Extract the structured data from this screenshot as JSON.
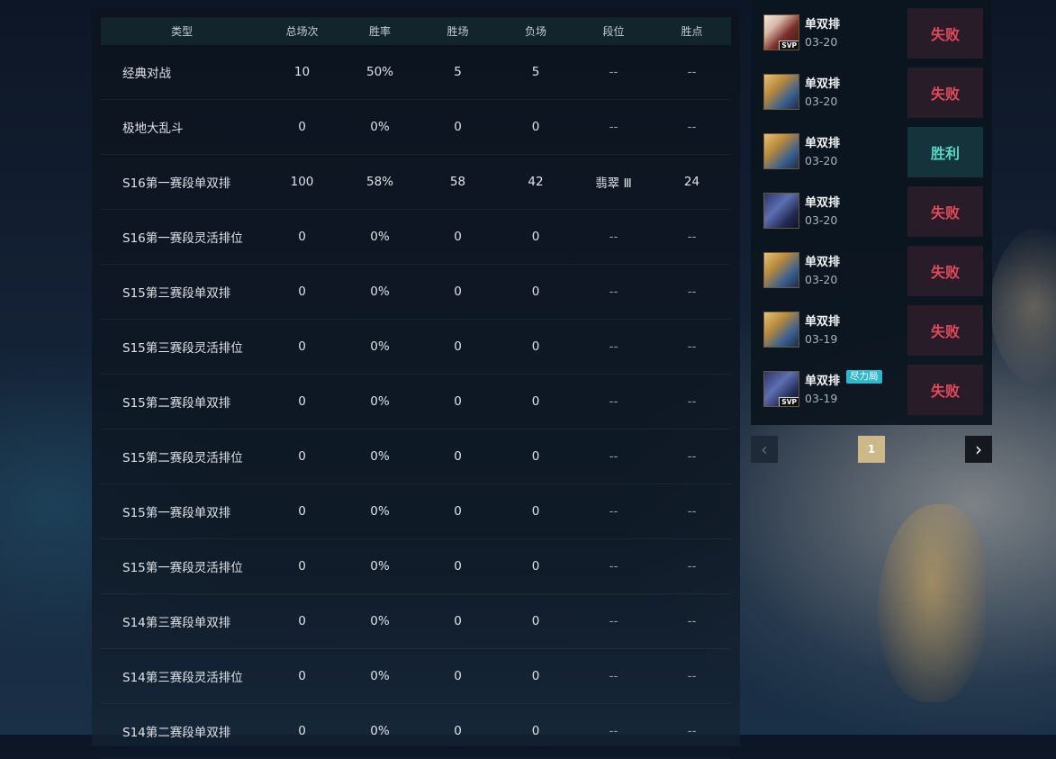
{
  "stats": {
    "columns": [
      "类型",
      "总场次",
      "胜率",
      "胜场",
      "负场",
      "段位",
      "胜点"
    ],
    "rows": [
      [
        "经典对战",
        "10",
        "50%",
        "5",
        "5",
        "--",
        "--"
      ],
      [
        "极地大乱斗",
        "0",
        "0%",
        "0",
        "0",
        "--",
        "--"
      ],
      [
        "S16第一赛段单双排",
        "100",
        "58%",
        "58",
        "42",
        "翡翠 Ⅲ",
        "24"
      ],
      [
        "S16第一赛段灵活排位",
        "0",
        "0%",
        "0",
        "0",
        "--",
        "--"
      ],
      [
        "S15第三赛段单双排",
        "0",
        "0%",
        "0",
        "0",
        "--",
        "--"
      ],
      [
        "S15第三赛段灵活排位",
        "0",
        "0%",
        "0",
        "0",
        "--",
        "--"
      ],
      [
        "S15第二赛段单双排",
        "0",
        "0%",
        "0",
        "0",
        "--",
        "--"
      ],
      [
        "S15第二赛段灵活排位",
        "0",
        "0%",
        "0",
        "0",
        "--",
        "--"
      ],
      [
        "S15第一赛段单双排",
        "0",
        "0%",
        "0",
        "0",
        "--",
        "--"
      ],
      [
        "S15第一赛段灵活排位",
        "0",
        "0%",
        "0",
        "0",
        "--",
        "--"
      ],
      [
        "S14第三赛段单双排",
        "0",
        "0%",
        "0",
        "0",
        "--",
        "--"
      ],
      [
        "S14第三赛段灵活排位",
        "0",
        "0%",
        "0",
        "0",
        "--",
        "--"
      ],
      [
        "S14第二赛段单双排",
        "0",
        "0%",
        "0",
        "0",
        "--",
        "--"
      ]
    ]
  },
  "history": {
    "matches": [
      {
        "mode": "单双排",
        "date": "03-20",
        "result": "失败",
        "avatar_style": "light",
        "svp": "SVP",
        "tag": ""
      },
      {
        "mode": "单双排",
        "date": "03-20",
        "result": "失败",
        "avatar_style": "blonde",
        "svp": "",
        "tag": ""
      },
      {
        "mode": "单双排",
        "date": "03-20",
        "result": "胜利",
        "avatar_style": "blonde",
        "svp": "",
        "tag": ""
      },
      {
        "mode": "单双排",
        "date": "03-20",
        "result": "失败",
        "avatar_style": "dark",
        "svp": "",
        "tag": ""
      },
      {
        "mode": "单双排",
        "date": "03-20",
        "result": "失败",
        "avatar_style": "blonde",
        "svp": "",
        "tag": ""
      },
      {
        "mode": "单双排",
        "date": "03-19",
        "result": "失败",
        "avatar_style": "blonde",
        "svp": "",
        "tag": ""
      },
      {
        "mode": "单双排",
        "date": "03-19",
        "result": "失败",
        "avatar_style": "dark",
        "svp": "SVP",
        "tag": "尽力局"
      }
    ],
    "result_colors": {
      "lose": "#e2495d",
      "win": "#57d8c7"
    }
  },
  "pager": {
    "prev_icon": "chevron-left-icon",
    "current_page": "1",
    "next_icon": "chevron-right-icon",
    "prev_glyph": "‹",
    "next_glyph": "›"
  }
}
